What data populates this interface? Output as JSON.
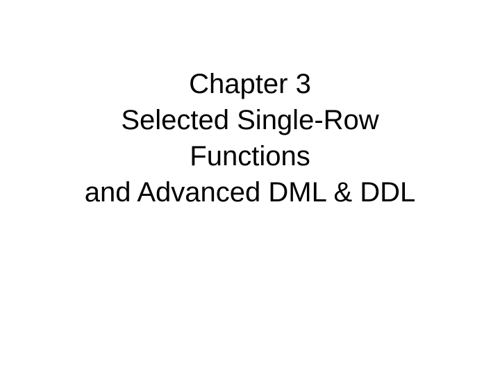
{
  "slide": {
    "title_line1": "Chapter 3",
    "title_line2": "Selected Single-Row",
    "title_line3": "Functions",
    "title_line4": "and Advanced DML & DDL"
  }
}
